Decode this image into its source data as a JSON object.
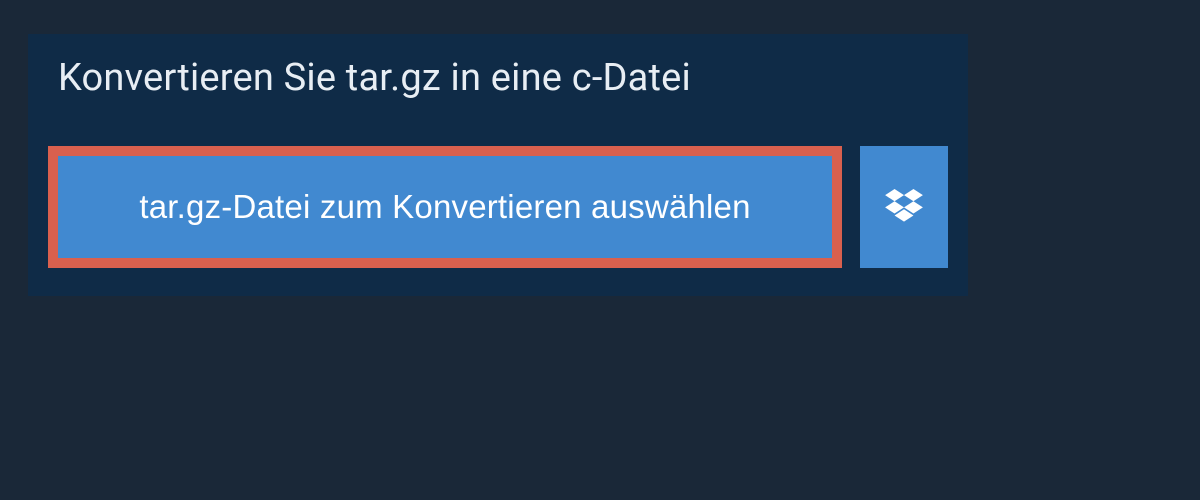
{
  "header": {
    "title": "Konvertieren Sie tar.gz in eine c-Datei"
  },
  "actions": {
    "select_file_label": "tar.gz-Datei zum Konvertieren auswählen"
  },
  "colors": {
    "accent": "#4189d0",
    "highlight_border": "#d9604e",
    "panel": "#0f2b47",
    "page": "#1a2838"
  }
}
